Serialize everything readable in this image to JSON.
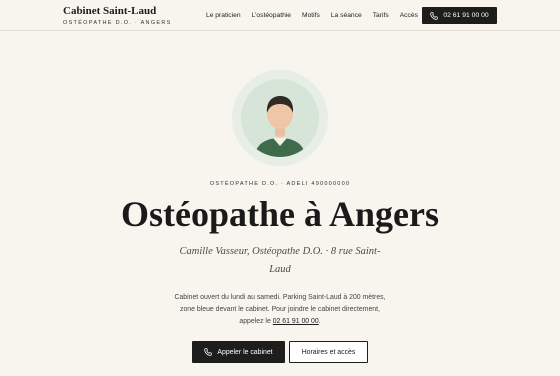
{
  "brand": {
    "name": "Cabinet Saint-Laud",
    "subtitle": "OSTÉOPATHE D.O. · ANGERS"
  },
  "nav": {
    "items": [
      "Le praticien",
      "L’ostéopathie",
      "Motifs",
      "La séance",
      "Tarifs",
      "Accès"
    ]
  },
  "header_phone": {
    "label": "02 61 91 00 00",
    "icon": "phone-icon"
  },
  "avatar": {
    "icon": "practitioner-avatar-icon"
  },
  "hero": {
    "kicker": "OSTÉOPATHE D.O. · ADELI 490000000",
    "title": "Ostéopathe à Angers",
    "subtitle": "Camille Vasseur, Ostéopathe D.O. · 8 rue Saint-Laud",
    "intro_text": "Cabinet ouvert du lundi au samedi. Parking Saint-Laud à 200 mètres, zone bleue devant le cabinet. Pour joindre le cabinet directement, appelez le ",
    "intro_phone": "02 61 91 00 00",
    "intro_end": "."
  },
  "cta": {
    "call_label": "Appeler le cabinet",
    "hours_label": "Horaires et accès"
  },
  "colors": {
    "background": "#f8f5ef",
    "dark": "#1d1d1b",
    "avatar_bg": "#d7e5d9",
    "shirt": "#3f6b4a"
  }
}
